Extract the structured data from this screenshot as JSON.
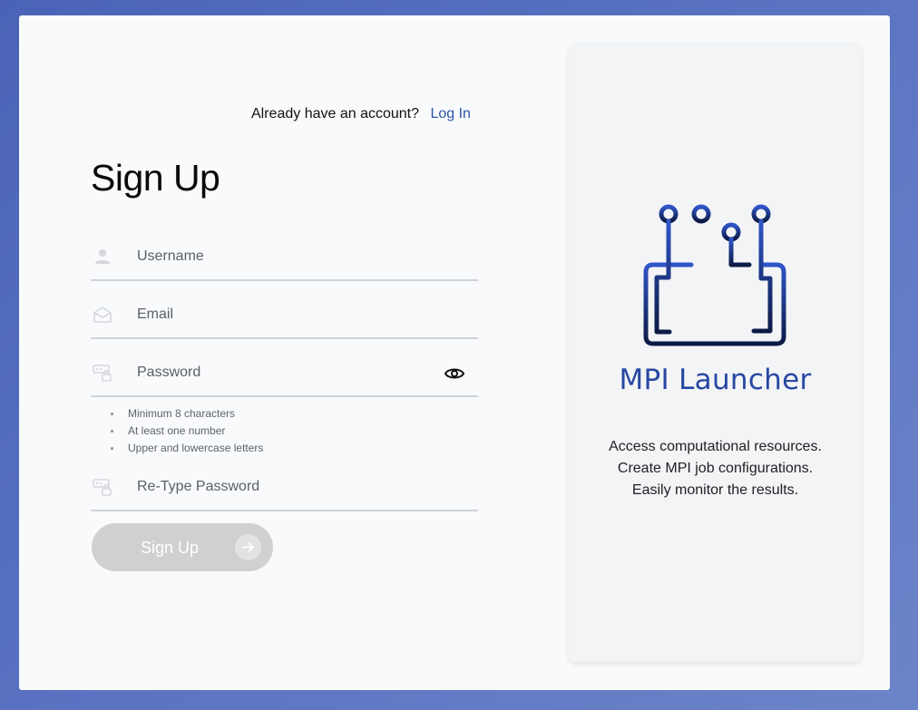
{
  "login_prompt": {
    "text": "Already have an account?",
    "link": "Log In"
  },
  "form": {
    "title": "Sign Up",
    "fields": {
      "username": {
        "placeholder": "Username",
        "value": "",
        "icon": "user-icon"
      },
      "email": {
        "placeholder": "Email",
        "value": "",
        "icon": "envelope-icon"
      },
      "password": {
        "placeholder": "Password",
        "value": "",
        "icon": "password-key-icon",
        "toggle_icon": "eye-icon"
      },
      "retype_password": {
        "placeholder": "Re-Type Password",
        "value": "",
        "icon": "password-key-icon"
      }
    },
    "password_rules": [
      "Minimum 8 characters",
      "At least one number",
      "Upper and lowercase letters"
    ],
    "submit": {
      "label": "Sign Up",
      "icon": "arrow-right-icon",
      "state": "disabled"
    }
  },
  "side_panel": {
    "logo_icon": "circuit-monitor-icon",
    "brand": "MPI Launcher",
    "tagline": [
      "Access computational resources.",
      "Create MPI job configurations.",
      "Easily monitor the results."
    ]
  },
  "colors": {
    "background": "#5a74c2",
    "link": "#2f56a8",
    "brand": "#2747a3",
    "logo_gradient_start": "#2f55c8",
    "logo_gradient_end": "#0c1a45",
    "button_disabled": "#cfd0d2"
  }
}
